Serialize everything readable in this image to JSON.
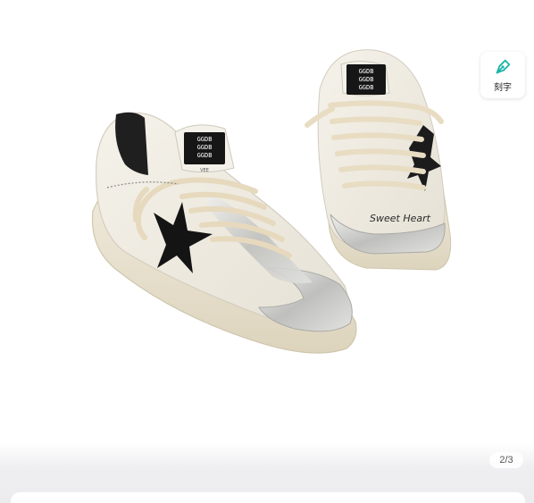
{
  "engrave": {
    "label": "刻字",
    "icon": "pen-nib-icon",
    "accent": "#1fb5a8"
  },
  "gallery": {
    "indicator": "2/3",
    "current": 2,
    "total": 3
  },
  "product_image": {
    "subject": "sneakers-pair",
    "heel_text": [
      "GGDB",
      "GGDB",
      "GGDB"
    ],
    "heel_sub": "VEE",
    "signature_text": "Sweet Heart"
  }
}
